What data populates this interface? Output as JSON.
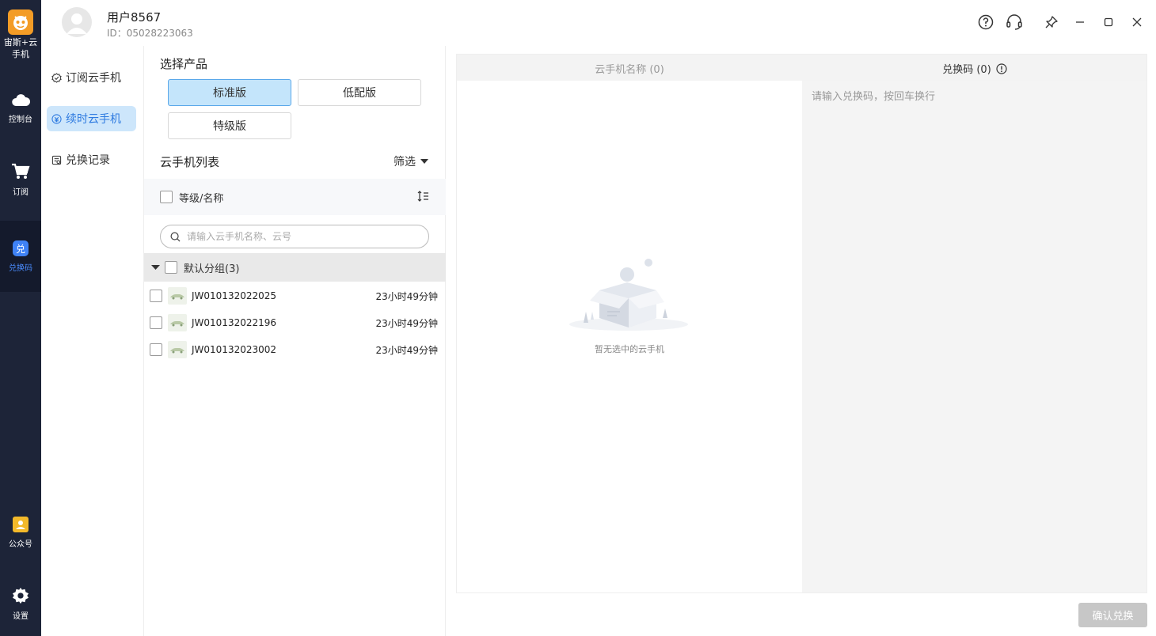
{
  "app": {
    "name": "宙斯+云手机"
  },
  "rail": {
    "items": [
      {
        "label": "控制台",
        "icon": "cloud-icon"
      },
      {
        "label": "订阅",
        "icon": "cart-icon"
      },
      {
        "label": "兑换码",
        "icon": "redeem-icon",
        "active": true
      },
      {
        "label": "公众号",
        "icon": "official-account-icon"
      },
      {
        "label": "设置",
        "icon": "gear-icon"
      }
    ]
  },
  "header": {
    "username": "用户8567",
    "user_id": "ID：05028223063"
  },
  "nav": {
    "items": [
      {
        "label": "订阅云手机",
        "icon": "subscribe-icon"
      },
      {
        "label": "续时云手机",
        "icon": "renew-icon",
        "active": true
      },
      {
        "label": "兑换记录",
        "icon": "record-icon"
      }
    ]
  },
  "product": {
    "title": "选择产品",
    "options": [
      {
        "label": "标准版",
        "active": true
      },
      {
        "label": "低配版"
      },
      {
        "label": "特级版"
      }
    ]
  },
  "phone_list": {
    "title": "云手机列表",
    "filter_label": "筛选",
    "column_header": "等级/名称",
    "search_placeholder": "请输入云手机名称、云号",
    "group_label": "默认分组(3)",
    "rows": [
      {
        "name": "JW010132022025",
        "time": "23小时49分钟"
      },
      {
        "name": "JW010132022196",
        "time": "23小时49分钟"
      },
      {
        "name": "JW010132023002",
        "time": "23小时49分钟"
      }
    ]
  },
  "right": {
    "left_header": "云手机名称 (0)",
    "right_header": "兑换码 (0)",
    "empty_text": "暂无选中的云手机",
    "code_placeholder": "请输入兑换码，按回车换行"
  },
  "confirm_label": "确认兑换",
  "colors": {
    "accent": "#2d7ae0",
    "sidebar": "#1d2438",
    "active_btn": "#c4e5fb",
    "logo": "#f39c26"
  }
}
